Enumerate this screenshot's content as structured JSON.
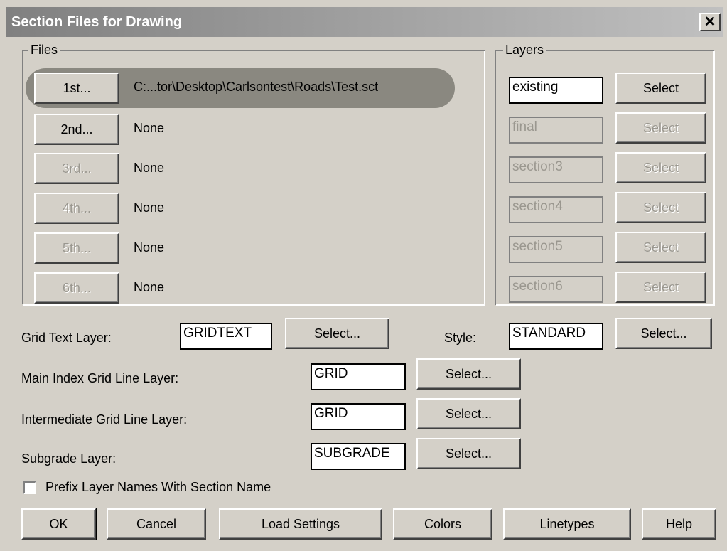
{
  "window": {
    "title": "Section Files for Drawing",
    "close_glyph": "✕"
  },
  "files": {
    "legend": "Files",
    "rows": [
      {
        "button": "1st...",
        "value": "C:...tor\\Desktop\\Carlsontest\\Roads\\Test.sct",
        "enabled": true
      },
      {
        "button": "2nd...",
        "value": "None",
        "enabled": true
      },
      {
        "button": "3rd...",
        "value": "None",
        "enabled": false
      },
      {
        "button": "4th...",
        "value": "None",
        "enabled": false
      },
      {
        "button": "5th...",
        "value": "None",
        "enabled": false
      },
      {
        "button": "6th...",
        "value": "None",
        "enabled": false
      }
    ]
  },
  "layers": {
    "legend": "Layers",
    "rows": [
      {
        "value": "existing",
        "button": "Select",
        "enabled": true
      },
      {
        "value": "final",
        "button": "Select",
        "enabled": false
      },
      {
        "value": "section3",
        "button": "Select",
        "enabled": false
      },
      {
        "value": "section4",
        "button": "Select",
        "enabled": false
      },
      {
        "value": "section5",
        "button": "Select",
        "enabled": false
      },
      {
        "value": "section6",
        "button": "Select",
        "enabled": false
      }
    ]
  },
  "grid_text": {
    "label": "Grid Text Layer:",
    "value": "GRIDTEXT",
    "button": "Select..."
  },
  "style": {
    "label": "Style:",
    "value": "STANDARD",
    "button": "Select..."
  },
  "main_index": {
    "label": "Main Index Grid Line Layer:",
    "value": "GRID",
    "button": "Select..."
  },
  "intermediate": {
    "label": "Intermediate Grid Line Layer:",
    "value": "GRID",
    "button": "Select..."
  },
  "subgrade": {
    "label": "Subgrade Layer:",
    "value": "SUBGRADE",
    "button": "Select..."
  },
  "prefix": {
    "label": "Prefix Layer Names With Section Name",
    "checked": false
  },
  "footer": {
    "ok": "OK",
    "cancel": "Cancel",
    "load_settings": "Load Settings",
    "colors": "Colors",
    "linetypes": "Linetypes",
    "help": "Help"
  }
}
